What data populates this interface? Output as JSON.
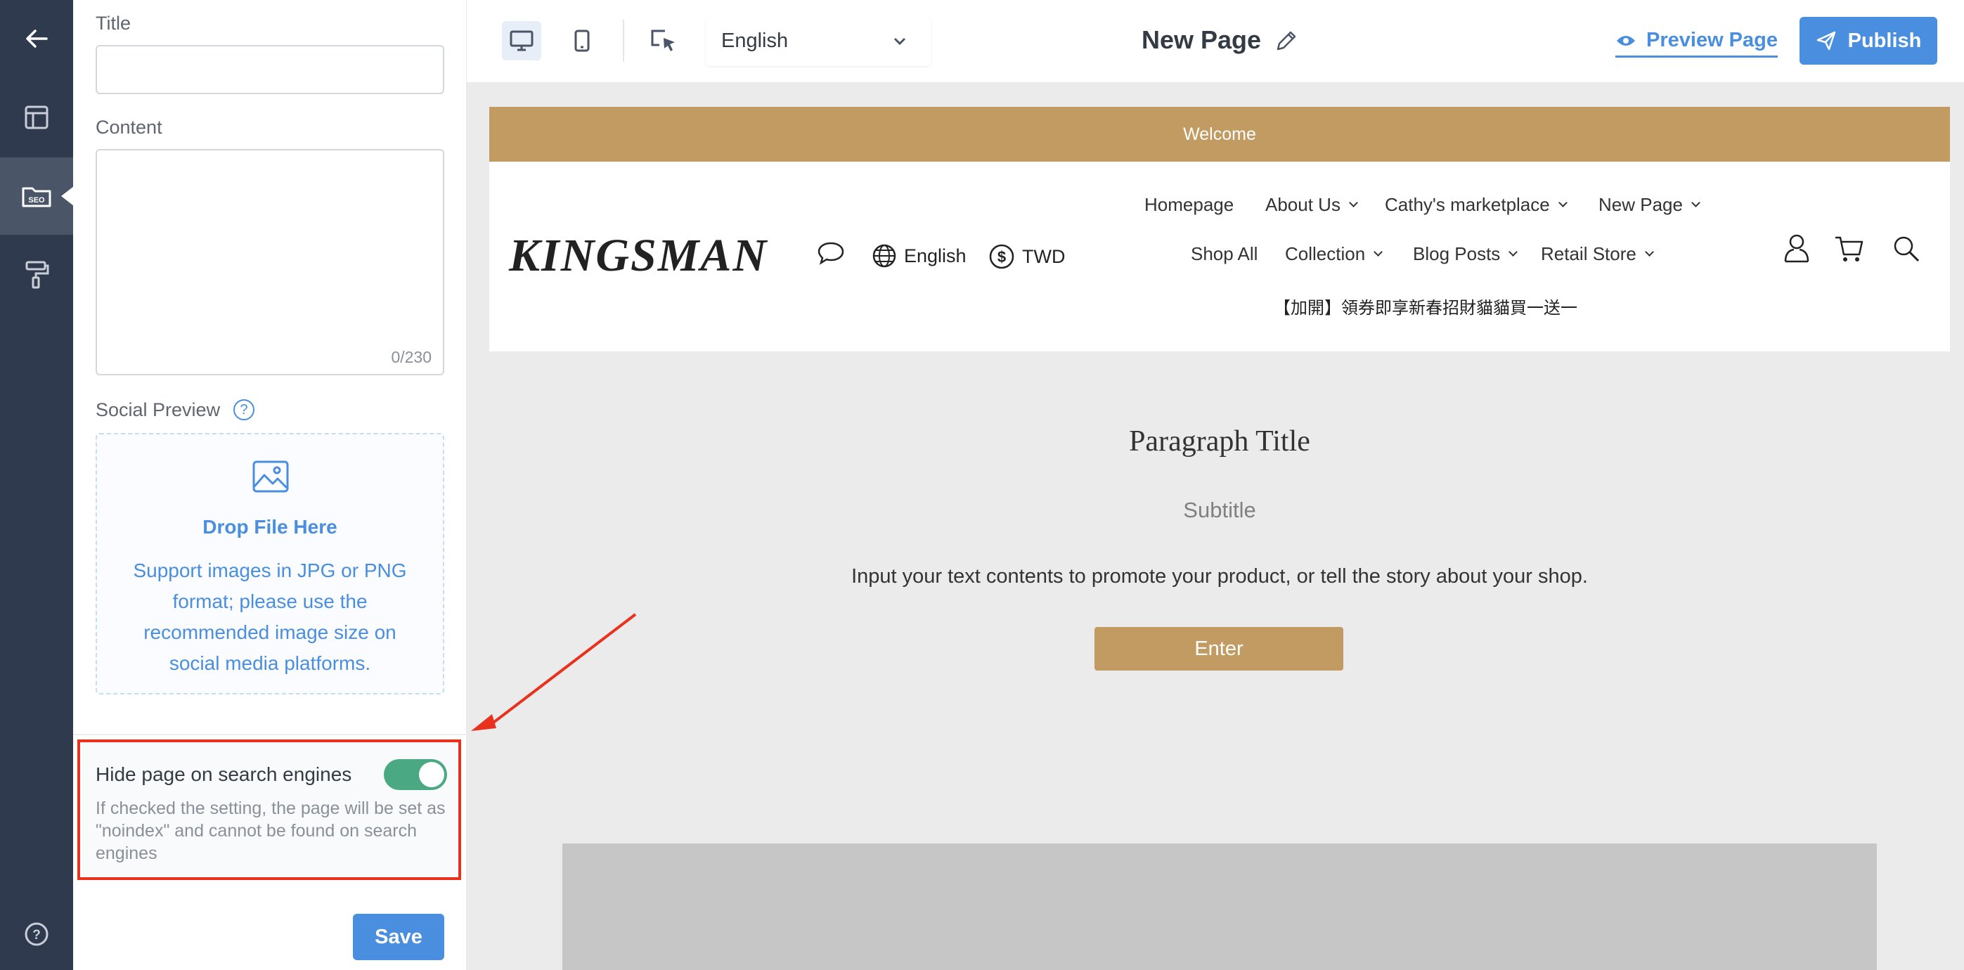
{
  "rail": {
    "items": [
      "back-arrow-icon",
      "layout-icon",
      "seo-icon",
      "paint-roller-icon",
      "help-icon"
    ],
    "seo_label": "SEO"
  },
  "panel": {
    "title_label": "Title",
    "title_value": "",
    "content_label": "Content",
    "content_value": "",
    "content_counter": "0/230",
    "social_label": "Social Preview",
    "drop_title": "Drop File Here",
    "drop_text": "Support images in JPG or PNG format; please use the recommended image size on social media platforms.",
    "hide_label": "Hide page on search engines",
    "hide_enabled": true,
    "hide_desc": "If checked the setting, the page will be set as \"noindex\" and cannot be found on search engines",
    "save_label": "Save"
  },
  "topbar": {
    "language": "English",
    "page_title": "New Page",
    "preview_label": "Preview Page",
    "publish_label": "Publish"
  },
  "site": {
    "welcome": "Welcome",
    "logo": "KINGSMAN",
    "language": "English",
    "currency": "TWD",
    "nav_row1": [
      "Homepage",
      "About Us",
      "Cathy's marketplace",
      "New Page"
    ],
    "nav_row2": [
      "Shop All",
      "Collection",
      "Blog Posts",
      "Retail Store"
    ],
    "promo": "【加開】領券即享新春招財貓貓買一送一",
    "para_title": "Paragraph Title",
    "para_subtitle": "Subtitle",
    "para_body": "Input your text contents to promote your product, or tell the story about your shop.",
    "enter_label": "Enter"
  },
  "colors": {
    "rail": "#2f3a4f",
    "accent": "#4a8ee0",
    "brand_gold": "#c29b62",
    "toggle_on": "#4aa982",
    "highlight": "#e8321e"
  }
}
